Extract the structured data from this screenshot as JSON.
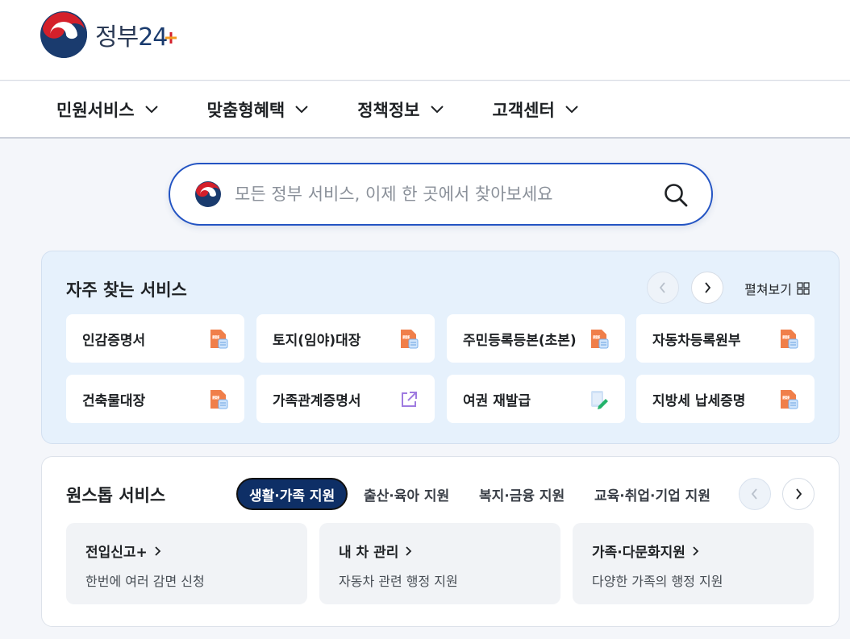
{
  "brand": {
    "name": "정부",
    "num": "24"
  },
  "gnb": [
    {
      "label": "민원서비스"
    },
    {
      "label": "맞춤형혜택"
    },
    {
      "label": "정책정보"
    },
    {
      "label": "고객센터"
    }
  ],
  "search": {
    "placeholder": "모든 정부 서비스, 이제 한 곳에서 찾아보세요"
  },
  "frequent": {
    "title": "자주 찾는 서비스",
    "spread_label": "펼쳐보기",
    "items": [
      {
        "label": "인감증명서",
        "icon": "pdf-icon"
      },
      {
        "label": "토지(임야)대장",
        "icon": "pdf-icon"
      },
      {
        "label": "주민등록등본(초본)",
        "icon": "pdf-icon"
      },
      {
        "label": "자동차등록원부",
        "icon": "pdf-icon"
      },
      {
        "label": "건축물대장",
        "icon": "pdf-icon"
      },
      {
        "label": "가족관계증명서",
        "icon": "external-link-icon"
      },
      {
        "label": "여권 재발급",
        "icon": "edit-document-icon"
      },
      {
        "label": "지방세 납세증명",
        "icon": "pdf-icon"
      }
    ]
  },
  "onestop": {
    "title": "원스톱 서비스",
    "tabs": [
      {
        "label": "생활·가족 지원",
        "active": true
      },
      {
        "label": "출산·육아 지원"
      },
      {
        "label": "복지·금융 지원"
      },
      {
        "label": "교육·취업·기업 지원"
      }
    ],
    "cards": [
      {
        "title": "전입신고+",
        "desc": "한번에 여러 감면 신청"
      },
      {
        "title": "내 차 관리",
        "desc": "자동차 관련 행정 지원"
      },
      {
        "title": "가족·다문화지원",
        "desc": "다양한 가족의 행정 지원"
      }
    ]
  },
  "colors": {
    "accent": "#2354c3",
    "active_tab": "#0e2f66",
    "panel": "#e6f1fc"
  }
}
